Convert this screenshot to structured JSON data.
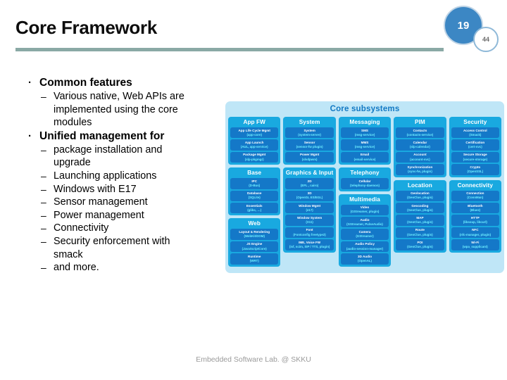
{
  "slide": {
    "title": "Core Framework",
    "page_badge": "19",
    "total_badge": "44",
    "footer": "Embedded Software Lab. @ SKKU",
    "accent_rule_color": "#8aa9a5",
    "badge_color": "#3c87c4"
  },
  "content": {
    "bullets": [
      {
        "level": 1,
        "marker": "·",
        "text": "Common features"
      },
      {
        "level": 2,
        "marker": "–",
        "text": "Various native, Web APIs are"
      },
      {
        "level": 2,
        "marker": "",
        "text": "implemented using the core"
      },
      {
        "level": 2,
        "marker": "",
        "text": "modules"
      },
      {
        "level": 1,
        "marker": "·",
        "text": "Unified management for"
      },
      {
        "level": 2,
        "marker": "–",
        "text": "package installation and"
      },
      {
        "level": 2,
        "marker": "",
        "text": "upgrade"
      },
      {
        "level": 2,
        "marker": "–",
        "text": "Launching applications"
      },
      {
        "level": 2,
        "marker": "–",
        "text": "Windows with E17"
      },
      {
        "level": 2,
        "marker": "–",
        "text": "Sensor management"
      },
      {
        "level": 2,
        "marker": "–",
        "text": "Power management"
      },
      {
        "level": 2,
        "marker": "–",
        "text": "Connectivity"
      },
      {
        "level": 2,
        "marker": "–",
        "text": "Security enforcement with"
      },
      {
        "level": 2,
        "marker": "",
        "text": "smack"
      },
      {
        "level": 2,
        "marker": "–",
        "text": "and more."
      }
    ]
  },
  "diagram": {
    "title": "Core subsystems",
    "panel_color": "#bfe6f7",
    "group_color": "#19a9e0",
    "item_color": "#1478c8",
    "title_color": "#1279c4",
    "impl_color": "#6ff0ff",
    "columns": [
      {
        "groups": [
          {
            "title": "App FW",
            "items": [
              {
                "name": "App Life Cycle  Mgmt",
                "impl": "(app-core)"
              },
              {
                "name": "App Launch",
                "impl": "(AUL, app-service)"
              },
              {
                "name": "Package Mgmt",
                "impl": "(slp-pkgmgr)"
              }
            ]
          },
          {
            "title": "Base",
            "items": [
              {
                "name": "IPC",
                "impl": "(D-Bus)"
              },
              {
                "name": "Database",
                "impl": "(SQLite)"
              },
              {
                "name": "Essentials",
                "impl": "(glibc, …)"
              }
            ]
          },
          {
            "title": "Web",
            "items": [
              {
                "name": "Layout & Rendering",
                "impl": "(WebKit/DOM)"
              },
              {
                "name": "JS Engine",
                "impl": "(JavaScriptCore)"
              },
              {
                "name": "Runtime",
                "impl": "(WRT)"
              }
            ]
          }
        ]
      },
      {
        "groups": [
          {
            "title": "System",
            "items": [
              {
                "name": "System",
                "impl": "(system-server)"
              },
              {
                "name": "Sensor",
                "impl": "(sensor-fw  plugin)"
              },
              {
                "name": "Power Mgmt",
                "impl": "(slvdpwm)"
              }
            ]
          },
          {
            "title": "Graphics & Input",
            "items": [
              {
                "name": "2D",
                "impl": "(EFL , cairo)"
              },
              {
                "name": "3D",
                "impl": "(OpenGL ES/EGL)"
              },
              {
                "name": "Window Mgmt",
                "impl": "(e17)"
              },
              {
                "name": "Window System",
                "impl": "(X11)"
              },
              {
                "name": "Font",
                "impl": "(Fontconfig  freetype2)"
              },
              {
                "name": "IME, Voice FW",
                "impl": "(isf, scim, SIP / TTS, plugin)"
              }
            ]
          }
        ]
      },
      {
        "groups": [
          {
            "title": "Messaging",
            "items": [
              {
                "name": "SMS",
                "impl": "(msg-service)"
              },
              {
                "name": "MMS",
                "impl": "(msg-service)"
              },
              {
                "name": "Email",
                "impl": "(email-service)"
              }
            ]
          },
          {
            "title": "Telephony",
            "items": [
              {
                "name": "Cellular",
                "impl": "(telephony-daemon)"
              }
            ]
          },
          {
            "title": "Multimedia",
            "items": [
              {
                "name": "Video",
                "impl": "(GStreamer, plugin)"
              },
              {
                "name": "Audio",
                "impl": "(GStreamer, PulseAudio)"
              },
              {
                "name": "Camera",
                "impl": "(GStreamer)"
              },
              {
                "name": "Audio Policy",
                "impl": "(audio-session-manager)"
              },
              {
                "name": "3D Audio",
                "impl": "(OpenAL)"
              }
            ]
          }
        ]
      },
      {
        "groups": [
          {
            "title": "PIM",
            "items": [
              {
                "name": "Contacts",
                "impl": "(contacts-service)"
              },
              {
                "name": "Calendar",
                "impl": "(slp-calendar)"
              },
              {
                "name": "Account",
                "impl": "(account-svc)"
              },
              {
                "name": "Synchronization",
                "impl": "(sync-fw,  plugin)"
              }
            ]
          },
          {
            "title": "Location",
            "items": [
              {
                "name": "Geolocation",
                "impl": "(GeoClue, plugin)"
              },
              {
                "name": "Geocoding",
                "impl": "(GeoClue, plugin)"
              },
              {
                "name": "MAP",
                "impl": "(GeoClue, plugin)"
              },
              {
                "name": "Route",
                "impl": "(GeoClue, plugin)"
              },
              {
                "name": "POI",
                "impl": "(GeoClue, plugin)"
              }
            ]
          }
        ]
      },
      {
        "groups": [
          {
            "title": "Security",
            "items": [
              {
                "name": "Access Control",
                "impl": "(Smack)"
              },
              {
                "name": "Certification",
                "impl": "(cert-svc)"
              },
              {
                "name": "Secure Storage",
                "impl": "(secure-storage)"
              },
              {
                "name": "Crypto",
                "impl": "(OpenSSL)"
              }
            ]
          },
          {
            "title": "Connectivity",
            "items": [
              {
                "name": "Connection",
                "impl": "(ConnMan)"
              },
              {
                "name": "Bluetooth",
                "impl": "(Bluez)"
              },
              {
                "name": "HTTP",
                "impl": "(libsoup, libcurl)"
              },
              {
                "name": "NFC",
                "impl": "(nfc-manager, plugin)"
              },
              {
                "name": "Wi-Fi",
                "impl": "(wpa_supplicant)"
              }
            ]
          }
        ]
      }
    ]
  }
}
